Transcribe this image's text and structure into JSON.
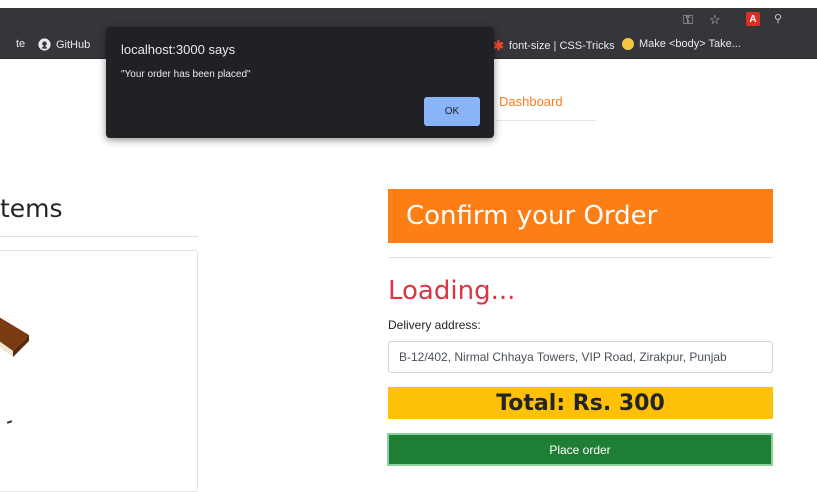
{
  "bookmarks": [
    {
      "label": "te",
      "icon": "none"
    },
    {
      "label": "GitHub",
      "icon": "github-icon"
    },
    {
      "label": "font-size | CSS-Tricks",
      "icon": "css-tricks-icon"
    },
    {
      "label": "Make <body> Take...",
      "icon": "smiley-icon"
    }
  ],
  "nav": {
    "dashboard": "Dashboard"
  },
  "left": {
    "heading": "tems"
  },
  "order": {
    "banner": "Confirm your Order",
    "loading": "Loading...",
    "address_label": "Delivery address:",
    "address_value": "B-12/402, Nirmal Chhaya Towers, VIP Road, Zirakpur, Punjab",
    "total": "Total: Rs. 300",
    "place_order": "Place order"
  },
  "alert": {
    "title": "localhost:3000 says",
    "message": "\"Your order has been placed\"",
    "ok": "OK"
  },
  "colors": {
    "accent_orange": "#fd7e14",
    "loading_red": "#dc3545",
    "total_yellow": "#ffc107",
    "button_green": "#1e7e34",
    "dialog_bg": "#202124",
    "dialog_button": "#8ab4f8"
  }
}
